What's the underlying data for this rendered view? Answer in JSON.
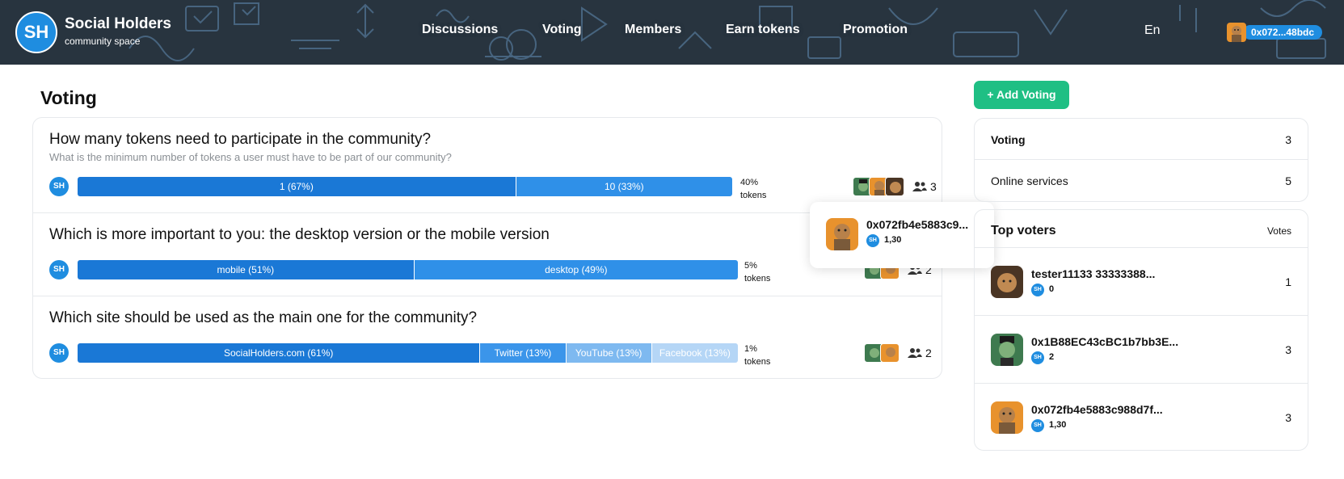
{
  "header": {
    "logo_text": "SH",
    "brand_title": "Social Holders",
    "brand_subtitle": "community space",
    "nav": [
      "Discussions",
      "Voting",
      "Members",
      "Earn tokens",
      "Promotion"
    ],
    "language": "En",
    "wallet": "0x072...48bdc"
  },
  "page": {
    "title": "Voting"
  },
  "polls": [
    {
      "question": "How many tokens need to participate in the community?",
      "description": "What is the minimum number of tokens a user must have to be part of our community?",
      "token_badge": "SH",
      "options": [
        {
          "label": "1 (67%)",
          "percent": 67,
          "color": "#1a78d6"
        },
        {
          "label": "10 (33%)",
          "percent": 33,
          "color": "#2f90e8"
        }
      ],
      "quorum_percent": "40%",
      "quorum_unit": "tokens",
      "voter_count": "3"
    },
    {
      "question": "Which is more important to you: the desktop version or the mobile version",
      "description": "",
      "token_badge": "SH",
      "options": [
        {
          "label": "mobile (51%)",
          "percent": 51,
          "color": "#1a78d6"
        },
        {
          "label": "desktop (49%)",
          "percent": 49,
          "color": "#2f90e8"
        }
      ],
      "quorum_percent": "5%",
      "quorum_unit": "tokens",
      "voter_count": "2"
    },
    {
      "question": "Which site should be used as the main one for the community?",
      "description": "",
      "token_badge": "SH",
      "options": [
        {
          "label": "SocialHolders.com (61%)",
          "percent": 61,
          "color": "#1a78d6"
        },
        {
          "label": "Twitter (13%)",
          "percent": 13,
          "color": "#3b95ea"
        },
        {
          "label": "YouTube (13%)",
          "percent": 13,
          "color": "#7eb9f0"
        },
        {
          "label": "Facebook (13%)",
          "percent": 13,
          "color": "#b5d6f6"
        }
      ],
      "quorum_percent": "1%",
      "quorum_unit": "tokens",
      "voter_count": "2"
    }
  ],
  "tooltip": {
    "name": "0x072fb4e5883c9...",
    "token": "SH",
    "balance": "1,30"
  },
  "sidebar": {
    "add_button": "+ Add Voting",
    "stats": [
      {
        "label": "Voting",
        "count": "3"
      },
      {
        "label": "Online services",
        "count": "5"
      }
    ],
    "top_voters_title": "Top voters",
    "votes_header": "Votes",
    "top_voters": [
      {
        "name": "tester11133 33333388...",
        "token": "SH",
        "balance": "0",
        "votes": "1"
      },
      {
        "name": "0x1B88EC43cBC1b7bb3E...",
        "token": "SH",
        "balance": "2",
        "votes": "3"
      },
      {
        "name": "0x072fb4e5883c988d7f...",
        "token": "SH",
        "balance": "1,30",
        "votes": "3"
      }
    ]
  },
  "colors": {
    "header_bg": "#28343f",
    "brand_blue": "#1f8de0",
    "add_green": "#1fbf84"
  }
}
